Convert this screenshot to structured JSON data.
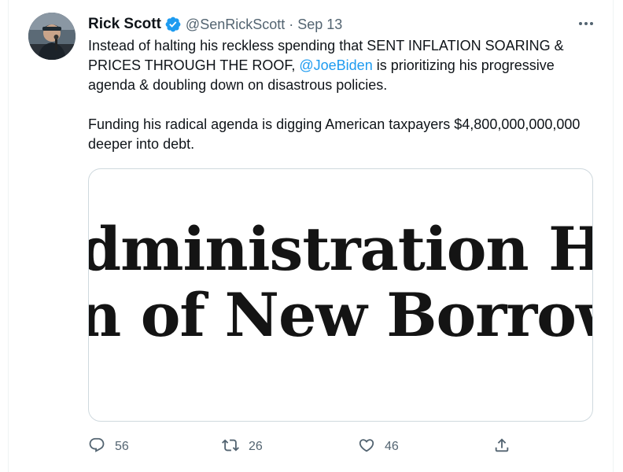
{
  "tweet": {
    "author": {
      "display_name": "Rick Scott",
      "handle": "@SenRickScott",
      "verified": true
    },
    "separator": "·",
    "date": "Sep 13",
    "text": {
      "paragraph1_prefix": "Instead of halting his reckless spending that SENT INFLATION SOARING & PRICES THROUGH THE ROOF, ",
      "mention": "@JoeBiden",
      "paragraph1_suffix": " is prioritizing his progressive agenda & doubling down on disastrous policies.",
      "paragraph2": "Funding his radical agenda is digging American taxpayers $4,800,000,000,000 deeper into debt."
    },
    "media": {
      "line1": "dministration H",
      "line2": "n of New Borrowi"
    },
    "actions": {
      "reply_count": "56",
      "retweet_count": "26",
      "like_count": "46"
    },
    "colors": {
      "accent": "#1d9bf0",
      "secondary_text": "#536471"
    }
  }
}
